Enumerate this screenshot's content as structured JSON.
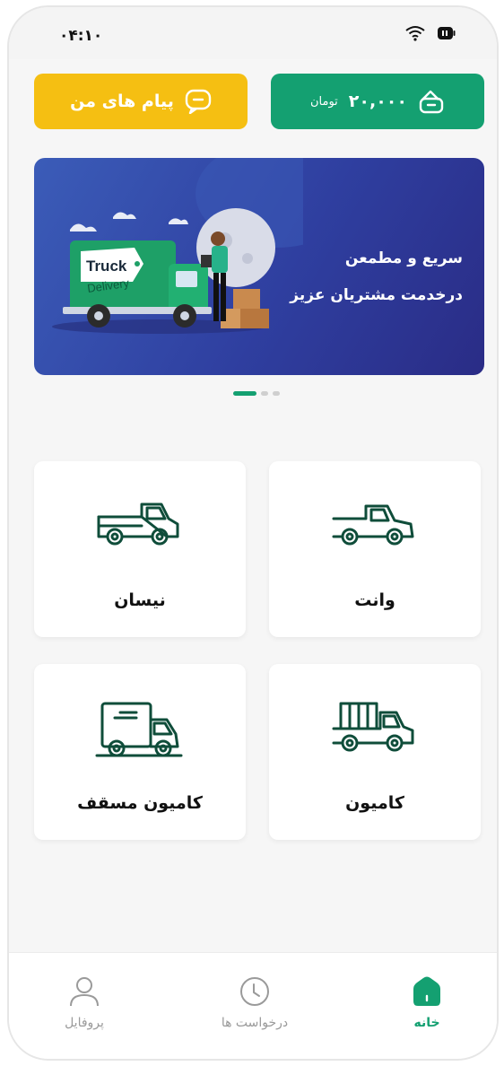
{
  "status_bar": {
    "time": "۰۴:۱۰"
  },
  "top_cards": {
    "messages_label": "پیام های من",
    "wallet_amount": "۲۰,۰۰۰",
    "wallet_unit": "تومان"
  },
  "banner": {
    "line1": "سریع و مطمعن",
    "line2": "درخدمت مشتریان عزیز",
    "truck_text1": "Truck",
    "truck_text2": "Delivery"
  },
  "carousel": {
    "total": 3,
    "active": 1
  },
  "vehicles": [
    {
      "label": "وانت",
      "icon": "pickup-icon"
    },
    {
      "label": "نیسان",
      "icon": "flatbed-truck-icon"
    },
    {
      "label": "کامیون",
      "icon": "cargo-truck-icon"
    },
    {
      "label": "کامیون مسقف",
      "icon": "covered-truck-icon"
    }
  ],
  "bottom_nav": [
    {
      "label": "خانه",
      "icon": "home-icon",
      "active": true
    },
    {
      "label": "درخواست ها",
      "icon": "clock-icon",
      "active": false
    },
    {
      "label": "پروفایل",
      "icon": "user-icon",
      "active": false
    }
  ],
  "colors": {
    "primary": "#14a071",
    "accent": "#f5bf12",
    "banner": "#2f3fa0"
  }
}
